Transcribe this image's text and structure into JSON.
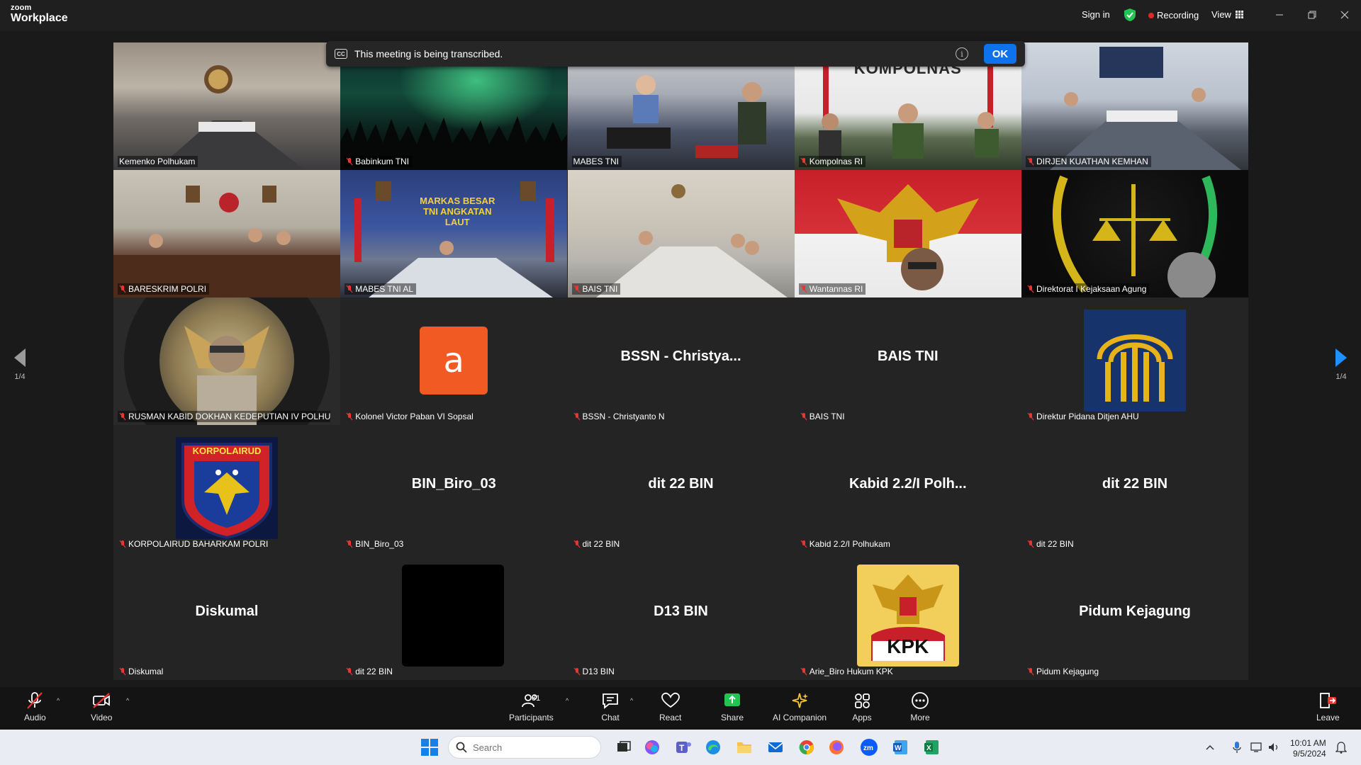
{
  "app": {
    "brand_top": "zoom",
    "brand_bottom": "Workplace"
  },
  "titlebar": {
    "sign_in": "Sign in",
    "recording": "Recording",
    "view": "View"
  },
  "banner": {
    "text": "This meeting is being transcribed.",
    "ok": "OK",
    "cc": "CC",
    "info": "i"
  },
  "pager": {
    "left": "1/4",
    "right": "1/4"
  },
  "tiles": [
    {
      "name": "Kemenko Polhukam"
    },
    {
      "name": "Babinkum TNI"
    },
    {
      "name": "MABES TNI"
    },
    {
      "name": "Kompolnas RI",
      "sign": "KOMPOLNAS"
    },
    {
      "name": "DIRJEN KUATHAN KEMHAN"
    },
    {
      "name": "BARESKRIM POLRI"
    },
    {
      "name": "MABES TNI AL",
      "sign": "MARKAS BESAR TNI ANGKATAN LAUT"
    },
    {
      "name": "BAIS TNI"
    },
    {
      "name": "Wantannas RI"
    },
    {
      "name": "Direktorat I Kejaksaan Agung"
    },
    {
      "name": "RUSMAN KABID DOKHAN KEDEPUTIAN IV POLHUKAM"
    },
    {
      "name": "Kolonel Victor Paban VI Sopsal",
      "avatar": "a"
    },
    {
      "name": "BSSN - Christyanto N",
      "display": "BSSN - Christya..."
    },
    {
      "name": "BAIS TNI",
      "display": "BAIS TNI"
    },
    {
      "name": "Direktur Pidana Ditjen AHU"
    },
    {
      "name": "KORPOLAIRUD BAHARKAM POLRI",
      "badge": "KORPOLAIRUD"
    },
    {
      "name": "BIN_Biro_03",
      "display": "BIN_Biro_03"
    },
    {
      "name": "dit 22 BIN",
      "display": "dit 22 BIN"
    },
    {
      "name": "Kabid 2.2/I Polhukam",
      "display": "Kabid 2.2/I Polh..."
    },
    {
      "name": "dit 22 BIN",
      "display": "dit 22 BIN"
    },
    {
      "name": "Diskumal",
      "display": "Diskumal"
    },
    {
      "name": "dit 22 BIN"
    },
    {
      "name": "D13 BIN",
      "display": "D13 BIN"
    },
    {
      "name": "Arie_Biro Hukum KPK",
      "badge": "KPK"
    },
    {
      "name": "Pidum Kejagung",
      "display": "Pidum Kejagung"
    }
  ],
  "toolbar": {
    "audio": "Audio",
    "video": "Video",
    "participants": "Participants",
    "participant_count": "81",
    "chat": "Chat",
    "react": "React",
    "share": "Share",
    "ai": "AI Companion",
    "apps": "Apps",
    "more": "More",
    "leave": "Leave"
  },
  "taskbar": {
    "search_placeholder": "Search",
    "time": "10:01 AM",
    "date": "9/5/2024"
  },
  "colors": {
    "accent": "#0e72ed",
    "active_border": "#2ecc71",
    "recording": "#e02828",
    "share": "#23c552"
  }
}
